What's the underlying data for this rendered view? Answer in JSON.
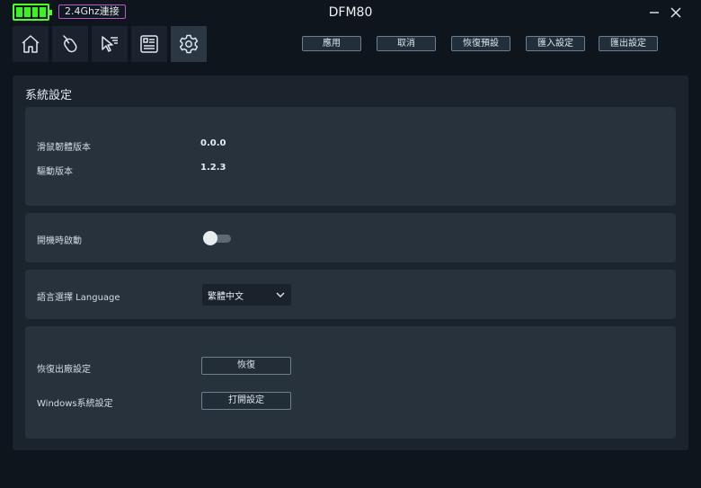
{
  "titlebar": {
    "connection_badge": "2.4Ghz連接",
    "title": "DFM80"
  },
  "nav": [
    {
      "icon": "home-icon"
    },
    {
      "icon": "mouse-icon"
    },
    {
      "icon": "cursor-icon"
    },
    {
      "icon": "profile-card-icon"
    },
    {
      "icon": "settings-gear-icon",
      "active": true
    }
  ],
  "actions": {
    "apply": "應用",
    "cancel": "取消",
    "restore_default": "恢復預設",
    "import": "匯入設定",
    "export": "匯出設定"
  },
  "system": {
    "title": "系統設定",
    "firmware_label": "滑鼠韌體版本",
    "firmware_value": "0.0.0",
    "driver_label": "驅動版本",
    "driver_value": "1.2.3",
    "startup_label": "開機時啟動",
    "startup_enabled": false,
    "language_label": "語言選擇 Language",
    "language_value": "繁體中文",
    "factory_reset_label": "恢復出廠設定",
    "factory_reset_button": "恢復",
    "windows_label": "Windows系統設定",
    "windows_button": "打開設定"
  },
  "colors": {
    "battery": "#39f51f",
    "badge_border": "#c256c9",
    "background": "#0e151c",
    "panel": "#1b242d",
    "card": "#27323d"
  }
}
